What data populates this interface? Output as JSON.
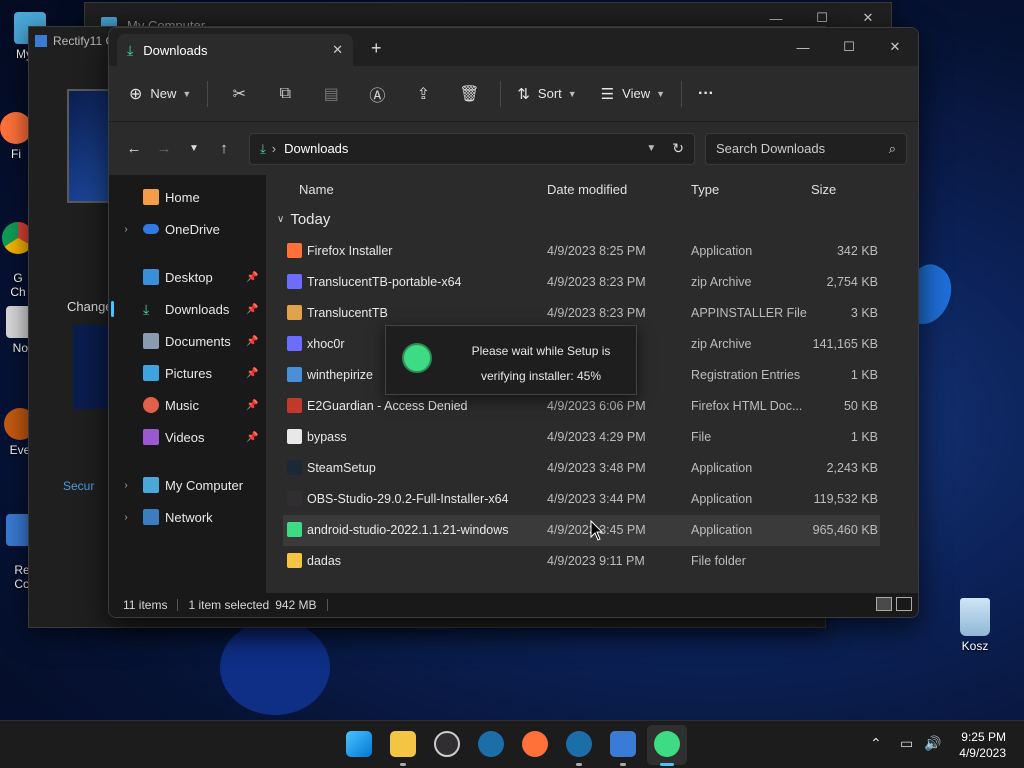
{
  "desktop": {
    "icons": [
      {
        "label": "My C"
      },
      {
        "label": "Fi"
      },
      {
        "label": "G\nCh"
      },
      {
        "label": "Not"
      },
      {
        "label": "Eve"
      },
      {
        "label": "Re\nCo"
      }
    ],
    "recycle_bin": "Kosz"
  },
  "back_windows": {
    "my_computer_title": "My Computer",
    "rectify_title": "Rectify11 C",
    "change_label": "Change",
    "security_label": "Secur"
  },
  "explorer": {
    "tab_title": "Downloads",
    "toolbar": {
      "new_label": "New",
      "sort_label": "Sort",
      "view_label": "View",
      "more_label": "···"
    },
    "address": {
      "path": "Downloads",
      "search_placeholder": "Search Downloads"
    },
    "sidebar": {
      "home": "Home",
      "onedrive": "OneDrive",
      "desktop": "Desktop",
      "downloads": "Downloads",
      "documents": "Documents",
      "pictures": "Pictures",
      "music": "Music",
      "videos": "Videos",
      "my_computer": "My Computer",
      "network": "Network"
    },
    "columns": {
      "name": "Name",
      "date": "Date modified",
      "type": "Type",
      "size": "Size"
    },
    "group": "Today",
    "files": [
      {
        "name": "Firefox Installer",
        "date": "4/9/2023 8:25 PM",
        "type": "Application",
        "size": "342 KB",
        "color": "#ff7139"
      },
      {
        "name": "TranslucentTB-portable-x64",
        "date": "4/9/2023 8:23 PM",
        "type": "zip Archive",
        "size": "2,754 KB",
        "color": "#6c6cff"
      },
      {
        "name": "TranslucentTB",
        "date": "4/9/2023 8:23 PM",
        "type": "APPINSTALLER File",
        "size": "3 KB",
        "color": "#e0a24a"
      },
      {
        "name": "xhoc0r",
        "date": "",
        "type": "zip Archive",
        "size": "141,165 KB",
        "color": "#6c6cff"
      },
      {
        "name": "winthepirize",
        "date": "",
        "type": "Registration Entries",
        "size": "1 KB",
        "color": "#4a90d9"
      },
      {
        "name": "E2Guardian - Access Denied",
        "date": "4/9/2023 6:06 PM",
        "type": "Firefox HTML Doc...",
        "size": "50 KB",
        "color": "#c0392b"
      },
      {
        "name": "bypass",
        "date": "4/9/2023 4:29 PM",
        "type": "File",
        "size": "1 KB",
        "color": "#e8e8e8"
      },
      {
        "name": "SteamSetup",
        "date": "4/9/2023 3:48 PM",
        "type": "Application",
        "size": "2,243 KB",
        "color": "#1b2838"
      },
      {
        "name": "OBS-Studio-29.0.2-Full-Installer-x64",
        "date": "4/9/2023 3:44 PM",
        "type": "Application",
        "size": "119,532 KB",
        "color": "#302e31"
      },
      {
        "name": "android-studio-2022.1.1.21-windows",
        "date": "4/9/2023 3:45 PM",
        "type": "Application",
        "size": "965,460 KB",
        "color": "#3ddc84"
      },
      {
        "name": "dadas",
        "date": "4/9/2023 9:11 PM",
        "type": "File folder",
        "size": "",
        "color": "#f4c542"
      }
    ],
    "status": {
      "items": "11 items",
      "selected": "1 item selected",
      "selected_size": "942 MB"
    }
  },
  "setup_popup": {
    "line1": "Please wait while Setup is",
    "line2": "verifying installer: 45%",
    "progress_percent": 45
  },
  "taskbar": {
    "time": "9:25 PM",
    "date": "4/9/2023"
  }
}
